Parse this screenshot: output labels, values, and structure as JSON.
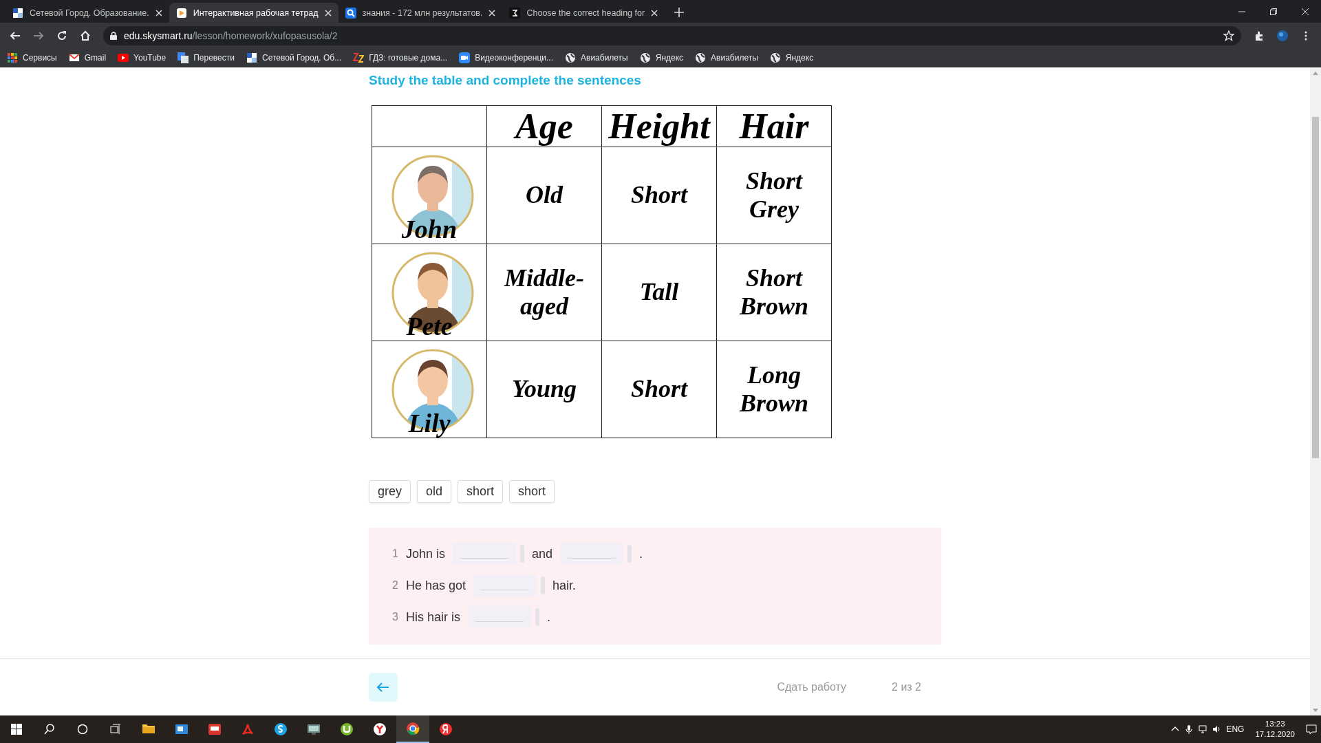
{
  "browser": {
    "tabs": [
      {
        "title": "Сетевой Город. Образование.",
        "selected": false
      },
      {
        "title": "Интерактивная рабочая тетрад",
        "selected": true
      },
      {
        "title": "знания - 172 млн результатов.",
        "selected": false
      },
      {
        "title": "Choose the correct heading for",
        "selected": false
      }
    ],
    "url": {
      "host": "edu.skysmart.ru",
      "path": "/lesson/homework/xufopasusola/2"
    },
    "bookmarks": [
      {
        "label": "Сервисы"
      },
      {
        "label": "Gmail"
      },
      {
        "label": "YouTube"
      },
      {
        "label": "Перевести"
      },
      {
        "label": "Сетевой Город. Об..."
      },
      {
        "label": "ГДЗ: готовые дома..."
      },
      {
        "label": "Видеоконференци..."
      },
      {
        "label": "Авиабилеты"
      },
      {
        "label": "Яндекс"
      },
      {
        "label": "Авиабилеты"
      },
      {
        "label": "Яндекс"
      }
    ]
  },
  "page": {
    "instruction": "Study the table and complete the sentences",
    "table": {
      "columns": [
        "Age",
        "Height",
        "Hair"
      ],
      "rows": [
        {
          "name": "John",
          "cells": [
            "Old",
            "Short",
            "Short Grey"
          ]
        },
        {
          "name": "Pete",
          "cells": [
            "Middle-aged",
            "Tall",
            "Short Brown"
          ]
        },
        {
          "name": "Lily",
          "cells": [
            "Young",
            "Short",
            "Long Brown"
          ]
        }
      ]
    },
    "word_bank": [
      "grey",
      "old",
      "short",
      "short"
    ],
    "sentences": [
      {
        "number": "1",
        "parts": [
          {
            "kind": "text",
            "text": "John is"
          },
          {
            "kind": "blank"
          },
          {
            "kind": "text",
            "text": "and"
          },
          {
            "kind": "blank"
          },
          {
            "kind": "text",
            "text": "."
          }
        ]
      },
      {
        "number": "2",
        "parts": [
          {
            "kind": "text",
            "text": "He has got"
          },
          {
            "kind": "blank"
          },
          {
            "kind": "text",
            "text": "hair."
          }
        ]
      },
      {
        "number": "3",
        "parts": [
          {
            "kind": "text",
            "text": "His hair is"
          },
          {
            "kind": "blank"
          },
          {
            "kind": "text",
            "text": "."
          }
        ]
      }
    ],
    "footer": {
      "submit": "Сдать работу",
      "pager": "2 из 2"
    }
  },
  "taskbar": {
    "apps": [
      {
        "selected": false
      },
      {
        "selected": false
      },
      {
        "selected": false
      },
      {
        "selected": false
      },
      {
        "selected": false
      },
      {
        "selected": false
      },
      {
        "selected": false
      },
      {
        "selected": false
      },
      {
        "selected": true
      },
      {
        "selected": false
      }
    ],
    "language": "ENG",
    "time": "13:23",
    "date": "17.12.2020"
  }
}
